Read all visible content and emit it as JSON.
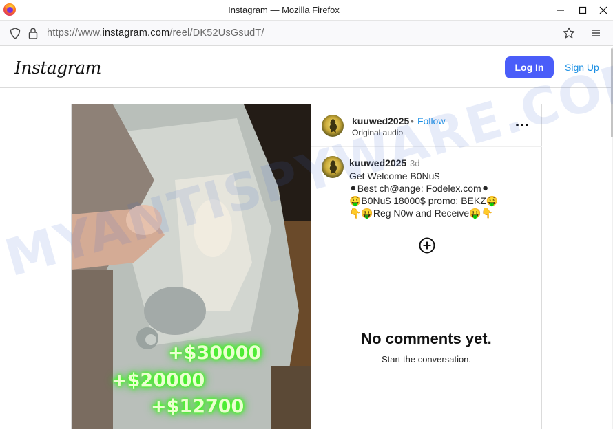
{
  "window": {
    "title": "Instagram — Mozilla Firefox",
    "app_icon": "firefox-icon"
  },
  "navbar": {
    "url_prefix": "https://www.",
    "url_host": "instagram.com",
    "url_path": "/reel/DK52UsGsudT/"
  },
  "header": {
    "logo": "Instagram",
    "login_label": "Log In",
    "signup_label": "Sign Up",
    "accent": "#4a5df9",
    "link_color": "#1a8fe3"
  },
  "post": {
    "username": "kuuwed2025",
    "separator": "•",
    "follow_label": "Follow",
    "audio": "Original audio",
    "caption": {
      "username": "kuuwed2025",
      "time": "3d",
      "lines": [
        "Get Welcome B0Nu$",
        "⚫Best ch@ange: Fodelex.com⚫",
        "🤑B0Nu$ 18000$ promo: BEKZ🤑",
        "👇🤑Reg N0w and Receive🤑👇"
      ]
    },
    "media_overlay": [
      "+$30000",
      "+$20000",
      "+$12700"
    ],
    "empty_title": "No comments yet.",
    "empty_subtitle": "Start the conversation."
  },
  "watermark": "MYANTISPYWARE.COM"
}
